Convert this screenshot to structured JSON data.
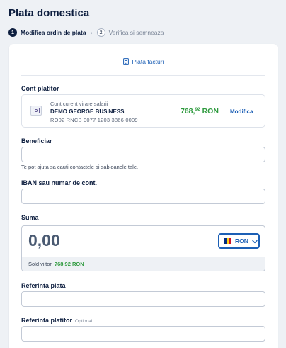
{
  "page": {
    "title": "Plata domestica"
  },
  "stepper": {
    "steps": [
      {
        "num": "1",
        "label": "Modifica ordin de plata"
      },
      {
        "num": "2",
        "label": "Verifica si semneaza"
      }
    ],
    "separator": "›"
  },
  "facturi": {
    "label": "Plata facturi"
  },
  "payer": {
    "section_label": "Cont platitor",
    "account_type": "Cont curent virare salarii",
    "account_name": "DEMO GEORGE BUSINESS",
    "iban": "RO02 RNCB 0077 1203 3866 0009",
    "balance_main": "768,",
    "balance_decimals": "92",
    "balance_currency": " RON",
    "modify_label": "Modifica"
  },
  "beneficiary": {
    "label": "Beneficiar",
    "value": "",
    "hint": "Te pot ajuta sa cauti contactele si sabloanele tale."
  },
  "iban_field": {
    "label": "IBAN sau numar de cont.",
    "value": ""
  },
  "amount": {
    "label": "Suma",
    "value": "0,00",
    "currency": "RON",
    "flag_colors": [
      "#002b7f",
      "#fcd116",
      "#ce1126"
    ],
    "sold_label": "Sold viitor",
    "sold_value": "768,92 RON"
  },
  "payment_ref": {
    "label": "Referinta plata",
    "value": ""
  },
  "payer_ref": {
    "label": "Referinta platitor",
    "optional": "Optional",
    "value": ""
  },
  "colors": {
    "accent": "#1c5fb5",
    "positive": "#2e9a3e",
    "primary": "#0d1e3f"
  }
}
